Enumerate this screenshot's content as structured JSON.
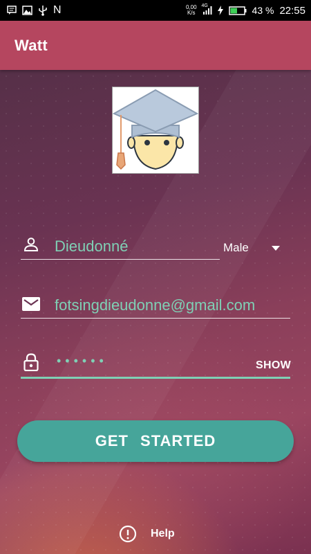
{
  "status_bar": {
    "net_speed_value": "0,00",
    "net_speed_unit": "K/s",
    "signal_label": "4G",
    "battery_percent": "43 %",
    "time": "22:55",
    "icons": [
      "message-icon",
      "image-icon",
      "usb-icon",
      "n-icon",
      "signal-icon",
      "charging-icon",
      "battery-icon"
    ],
    "n_label": "N"
  },
  "app_bar": {
    "title": "Watt"
  },
  "form": {
    "name": {
      "icon": "person-icon",
      "value": "Dieudonné"
    },
    "gender": {
      "selected": "Male"
    },
    "email": {
      "icon": "email-icon",
      "value": "fotsingdieudonne@gmail.com"
    },
    "password": {
      "icon": "lock-icon",
      "masked_value": "••••••",
      "toggle_label": "SHOW"
    }
  },
  "cta": {
    "label": "GET STARTED"
  },
  "help": {
    "icon": "info-icon",
    "label": "Help"
  },
  "colors": {
    "app_bar": "#b5465f",
    "accent": "#7fd0b5",
    "button": "#46a59a"
  }
}
